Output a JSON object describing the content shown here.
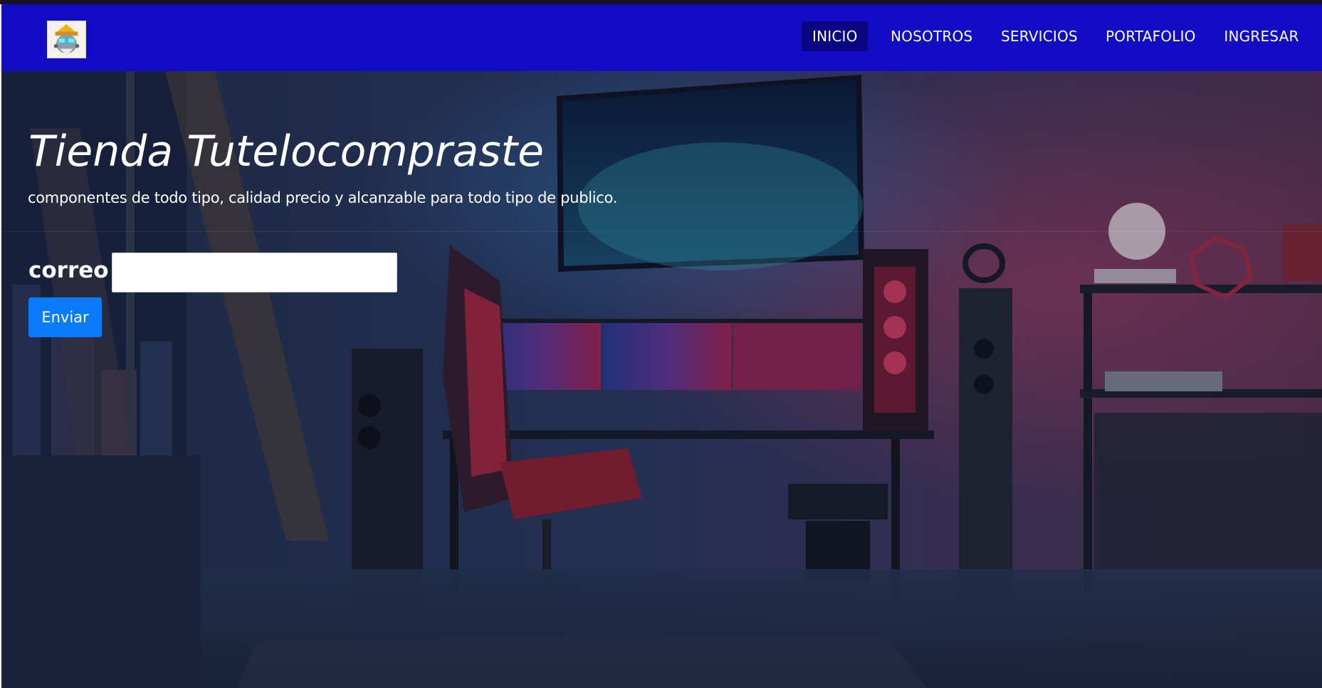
{
  "navbar": {
    "logo_icon": "robot-mascot-icon",
    "items": [
      {
        "label": "INICIO",
        "active": true
      },
      {
        "label": "NOSOTROS",
        "active": false
      },
      {
        "label": "SERVICIOS",
        "active": false
      },
      {
        "label": "PORTAFOLIO",
        "active": false
      },
      {
        "label": "INGRESAR",
        "active": false
      }
    ]
  },
  "hero": {
    "title": "Tienda Tutelocompraste",
    "subtitle": "componentes de todo tipo, calidad precio y alcanzable para todo tipo de publico.",
    "background_image": "gaming-room-photo",
    "form": {
      "email_label": "correo",
      "email_value": "",
      "submit_label": "Enviar"
    }
  },
  "colors": {
    "navbar": "#120cc4",
    "nav_active": "#0a0682",
    "button": "#0a7bfa",
    "top_strip": "#17121f"
  }
}
